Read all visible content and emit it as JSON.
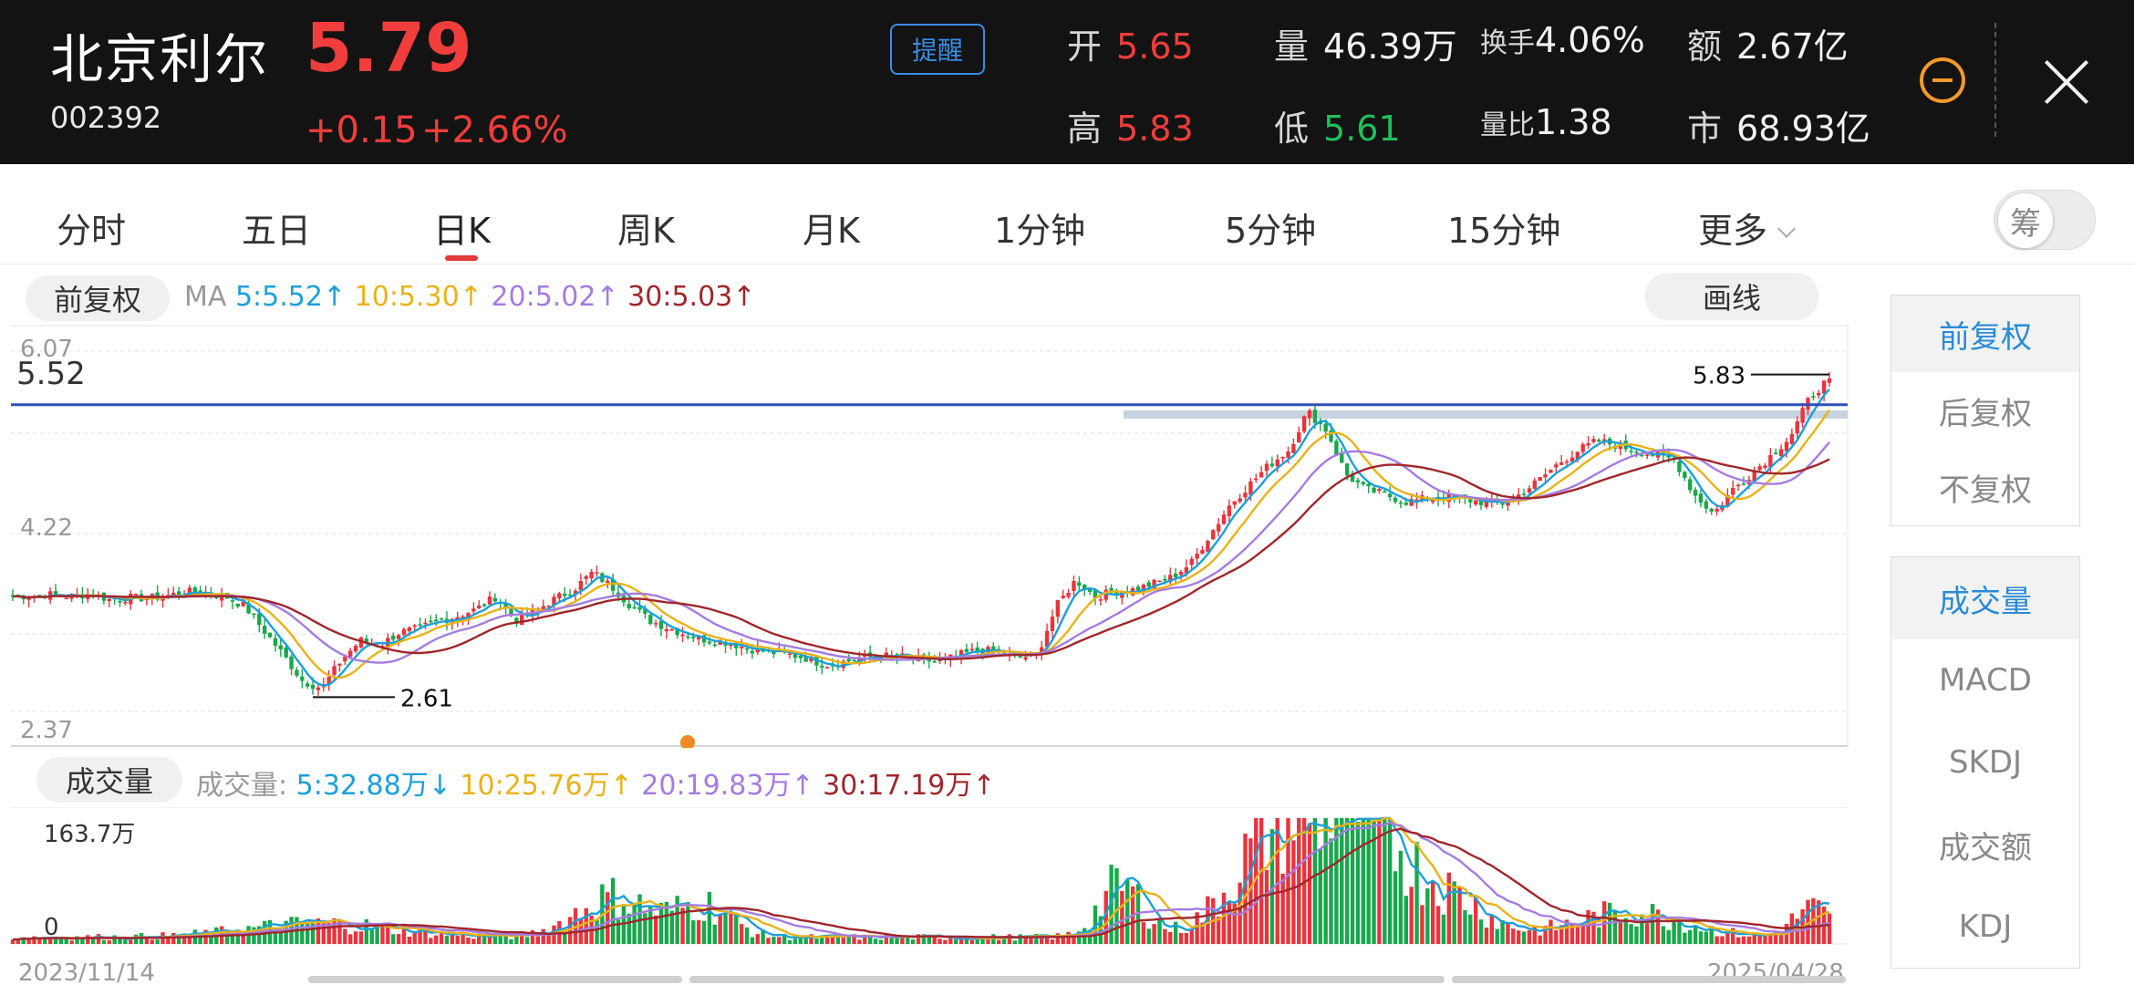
{
  "header": {
    "name": "北京利尔",
    "code": "002392",
    "price": "5.79",
    "change": "+0.15",
    "change_pct": "+2.66%",
    "alert_label": "提醒",
    "quotes": {
      "open_label": "开",
      "open": "5.65",
      "high_label": "高",
      "high": "5.83",
      "low_label": "低",
      "low": "5.61",
      "volume_label": "量",
      "volume": "46.39万",
      "turnover_label": "换手",
      "turnover": "4.06%",
      "vol_ratio_label": "量比",
      "vol_ratio": "1.38",
      "amount_label": "额",
      "amount": "2.67亿",
      "mktcap_label": "市",
      "mktcap": "68.93亿"
    }
  },
  "tabs": [
    "分时",
    "五日",
    "日K",
    "周K",
    "月K",
    "1分钟",
    "5分钟",
    "15分钟",
    "更多"
  ],
  "active_tab": "日K",
  "chip_toggle_label": "筹",
  "toolbar": {
    "adjust_label": "前复权",
    "draw_label": "画线",
    "ma_prefix": "MA",
    "ma5": "5:5.52",
    "ma10": "10:5.30",
    "ma20": "20:5.02",
    "ma30": "30:5.03",
    "up_arrow": "↑",
    "down_arrow": "↓"
  },
  "volume_panel": {
    "label": "成交量",
    "prefix": "成交量:",
    "v5": "5:32.88万",
    "v10": "10:25.76万",
    "v20": "20:19.83万",
    "v30": "30:17.19万",
    "max_label": "163.7万",
    "zero_label": "0"
  },
  "side_panel": {
    "adjust_options": [
      "前复权",
      "后复权",
      "不复权"
    ],
    "indicator_options": [
      "成交量",
      "MACD",
      "SKDJ",
      "成交额",
      "KDJ"
    ]
  },
  "chart_data": {
    "type": "candlestick",
    "x_start": "2023/11/14",
    "x_end": "2025/04/28",
    "y_axis_labels": [
      "6.07",
      "4.22",
      "2.37"
    ],
    "ylim": [
      2.37,
      6.07
    ],
    "crosshair_value": "5.52",
    "max_annotation": "5.83",
    "min_annotation": "2.61",
    "max_price": 5.83,
    "min_price": 2.61,
    "close_path": [
      3.55,
      3.56,
      3.57,
      3.55,
      3.58,
      3.52,
      3.54,
      3.53,
      3.56,
      3.6,
      3.58,
      3.55,
      3.45,
      3.2,
      2.95,
      2.68,
      2.61,
      2.9,
      3.1,
      3.05,
      3.18,
      3.22,
      3.3,
      3.35,
      3.42,
      3.55,
      3.3,
      3.4,
      3.52,
      3.62,
      3.8,
      3.65,
      3.45,
      3.3,
      3.22,
      3.15,
      3.1,
      3.08,
      3.02,
      2.98,
      2.96,
      2.92,
      2.85,
      2.88,
      2.92,
      2.94,
      2.93,
      2.9,
      2.88,
      2.95,
      3.0,
      2.98,
      2.92,
      2.95,
      3.45,
      3.72,
      3.55,
      3.6,
      3.62,
      3.68,
      3.75,
      3.9,
      4.2,
      4.5,
      4.7,
      4.9,
      5.05,
      5.45,
      5.25,
      4.8,
      4.65,
      4.6,
      4.52,
      4.55,
      4.58,
      4.55,
      4.52,
      4.5,
      4.6,
      4.75,
      4.92,
      5.05,
      5.15,
      5.1,
      5.05,
      5.0,
      4.95,
      4.6,
      4.4,
      4.65,
      4.82,
      5.0,
      5.2,
      5.6,
      5.79
    ],
    "volume_max": "163.7万"
  }
}
